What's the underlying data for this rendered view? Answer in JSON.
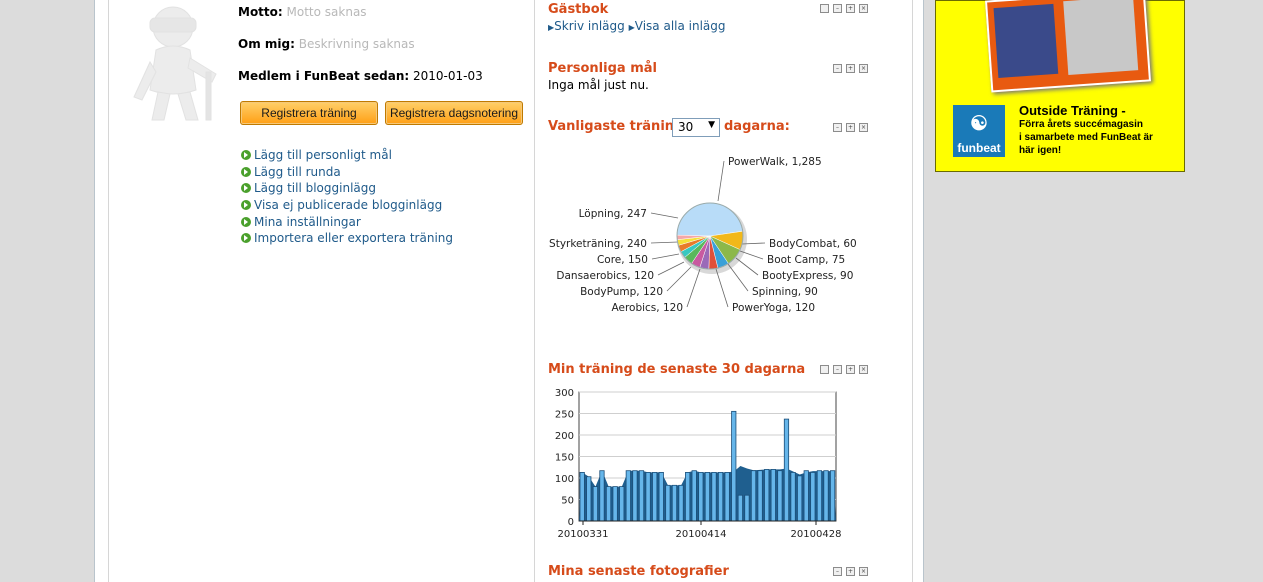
{
  "profile": {
    "motto_label": "Motto:",
    "motto_value": "Motto saknas",
    "about_label": "Om mig:",
    "about_value": "Beskrivning saknas",
    "member_label": "Medlem i FunBeat sedan:",
    "member_value": "2010-01-03"
  },
  "buttons": {
    "register_training": "Registrera träning",
    "register_daynote": "Registrera dagsnotering"
  },
  "links": [
    "Lägg till personligt mål",
    "Lägg till runda",
    "Lägg till blogginlägg",
    "Visa ej publicerade blogginlägg",
    "Mina inställningar",
    "Importera eller exportera träning"
  ],
  "guestbook": {
    "title": "Gästbok",
    "write": "Skriv inlägg",
    "show_all": "Visa alla inlägg"
  },
  "goals": {
    "title": "Personliga mål",
    "text": "Inga mål just nu."
  },
  "common": {
    "title_pre": "Vanligaste träning",
    "days": "30",
    "title_post": "dagarna:"
  },
  "recent": {
    "title": "Min träning de senaste 30 dagarna"
  },
  "photos": {
    "title": "Mina senaste fotografier"
  },
  "ad": {
    "title": "Outside Träning",
    "dash": "-",
    "text1": "Förra årets succémagasin",
    "text2": "i samarbete med FunBeat är",
    "text3": "här igen!",
    "logo": "funbeat"
  },
  "colors": {
    "accent": "#d64b1a",
    "link": "#1f5a8a",
    "ad_bg": "#ffff00"
  },
  "chart_data": [
    {
      "type": "pie",
      "slices": [
        {
          "label": "PowerWalk, 1,285",
          "value": 1285,
          "color": "#b8dcf8"
        },
        {
          "label": "Löpning, 247",
          "value": 247,
          "color": "#f2b81a"
        },
        {
          "label": "Styrketräning, 240",
          "value": 240,
          "color": "#8cb84a"
        },
        {
          "label": "Core, 150",
          "value": 150,
          "color": "#3aa0d8"
        },
        {
          "label": "Dansaerobics, 120",
          "value": 120,
          "color": "#e0503a"
        },
        {
          "label": "BodyPump, 120",
          "value": 120,
          "color": "#9a6ab8"
        },
        {
          "label": "Aerobics, 120",
          "value": 120,
          "color": "#c85aa0"
        },
        {
          "label": "PowerYoga, 120",
          "value": 120,
          "color": "#5ab85a"
        },
        {
          "label": "Spinning, 90",
          "value": 90,
          "color": "#38c8c0"
        },
        {
          "label": "BootyExpress, 90",
          "value": 90,
          "color": "#e87a2a"
        },
        {
          "label": "Boot Camp, 75",
          "value": 75,
          "color": "#f5e03a"
        },
        {
          "label": "BodyCombat, 60",
          "value": 60,
          "color": "#f5a8a8"
        }
      ]
    },
    {
      "type": "bar",
      "xlabels": [
        "20100331",
        "20100414",
        "20100428"
      ],
      "ylim": [
        0,
        300
      ],
      "yticks": [
        0,
        50,
        100,
        150,
        200,
        250,
        300
      ],
      "values": [
        113,
        103,
        80,
        117,
        80,
        80,
        80,
        117,
        117,
        117,
        113,
        113,
        113,
        83,
        83,
        83,
        113,
        117,
        113,
        113,
        113,
        113,
        113,
        255,
        60,
        60,
        117,
        117,
        120,
        120,
        117,
        237,
        113,
        105,
        117,
        113,
        117,
        117,
        117
      ],
      "average": [
        113,
        103,
        80,
        117,
        80,
        80,
        80,
        117,
        117,
        117,
        113,
        113,
        113,
        83,
        83,
        83,
        113,
        117,
        113,
        113,
        113,
        113,
        113,
        115,
        128,
        122,
        118,
        119,
        120,
        120,
        120,
        122,
        115,
        108,
        113,
        116,
        116,
        116,
        116
      ]
    }
  ]
}
